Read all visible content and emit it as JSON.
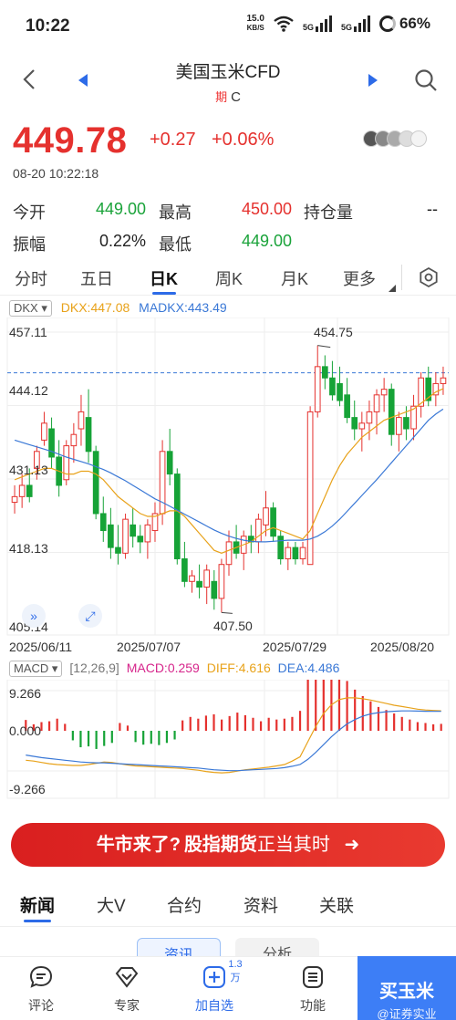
{
  "status": {
    "time": "10:22",
    "net_speed": "15.0",
    "net_unit": "KB/S",
    "sig1": "5G",
    "sig2": "5G",
    "battery": "66%"
  },
  "header": {
    "title": "美国玉米CFD",
    "badge": "期",
    "code": "C"
  },
  "quote": {
    "price": "449.78",
    "change": "+0.27",
    "change_pct": "+0.06%",
    "time": "08-20 10:22:18"
  },
  "stats": [
    {
      "label": "今开",
      "value": "449.00",
      "color": "green"
    },
    {
      "label": "最高",
      "value": "450.00",
      "color": "red"
    },
    {
      "label": "持仓量",
      "value": "--",
      "color": "plain"
    },
    {
      "label": "振幅",
      "value": "0.22%",
      "color": "plain"
    },
    {
      "label": "最低",
      "value": "449.00",
      "color": "green"
    }
  ],
  "tabs": [
    "分时",
    "五日",
    "日K",
    "周K",
    "月K",
    "更多"
  ],
  "active_tab": "日K",
  "kline": {
    "indicator": "DKX",
    "dkx_label": "DKX:447.08",
    "madkx_label": "MADKX:443.49",
    "y_ticks": [
      "457.11",
      "444.12",
      "431.13",
      "418.13",
      "405.14"
    ],
    "x_ticks": [
      "2025/06/11",
      "2025/07/07",
      "2025/07/29",
      "2025/08/20"
    ],
    "high_label": "454.75",
    "low_label": "407.50"
  },
  "macd": {
    "indicator": "MACD",
    "params": "[12,26,9]",
    "macd_label": "MACD:0.259",
    "diff_label": "DIFF:4.616",
    "dea_label": "DEA:4.486",
    "y_ticks": [
      "9.266",
      "0.000",
      "-9.266"
    ]
  },
  "chart_data": {
    "type": "candlestick",
    "ylim": [
      405.14,
      457.11
    ],
    "candles": [
      {
        "o": 427,
        "h": 430,
        "l": 425,
        "c": 428
      },
      {
        "o": 428,
        "h": 432,
        "l": 426,
        "c": 430
      },
      {
        "o": 430,
        "h": 433,
        "l": 427,
        "c": 428
      },
      {
        "o": 433,
        "h": 437,
        "l": 431,
        "c": 436
      },
      {
        "o": 438,
        "h": 443,
        "l": 437,
        "c": 441
      },
      {
        "o": 440,
        "h": 442,
        "l": 433,
        "c": 435
      },
      {
        "o": 435,
        "h": 438,
        "l": 428,
        "c": 430
      },
      {
        "o": 431,
        "h": 438,
        "l": 430,
        "c": 437
      },
      {
        "o": 437,
        "h": 441,
        "l": 434,
        "c": 439
      },
      {
        "o": 440,
        "h": 446,
        "l": 437,
        "c": 443
      },
      {
        "o": 442,
        "h": 447,
        "l": 434,
        "c": 436
      },
      {
        "o": 436,
        "h": 437,
        "l": 424,
        "c": 425
      },
      {
        "o": 425,
        "h": 428,
        "l": 420,
        "c": 422
      },
      {
        "o": 423,
        "h": 426,
        "l": 417,
        "c": 419
      },
      {
        "o": 419,
        "h": 423,
        "l": 416,
        "c": 418
      },
      {
        "o": 418,
        "h": 425,
        "l": 417,
        "c": 424
      },
      {
        "o": 423,
        "h": 426,
        "l": 419,
        "c": 421
      },
      {
        "o": 421,
        "h": 423,
        "l": 418,
        "c": 420
      },
      {
        "o": 420,
        "h": 424,
        "l": 417,
        "c": 423
      },
      {
        "o": 422,
        "h": 427,
        "l": 420,
        "c": 425
      },
      {
        "o": 425,
        "h": 438,
        "l": 423,
        "c": 436
      },
      {
        "o": 436,
        "h": 440,
        "l": 430,
        "c": 432
      },
      {
        "o": 432,
        "h": 433,
        "l": 416,
        "c": 417
      },
      {
        "o": 417,
        "h": 420,
        "l": 412,
        "c": 413
      },
      {
        "o": 413,
        "h": 415,
        "l": 411,
        "c": 414
      },
      {
        "o": 413,
        "h": 416,
        "l": 410,
        "c": 412
      },
      {
        "o": 412,
        "h": 416,
        "l": 409,
        "c": 415
      },
      {
        "o": 413,
        "h": 415,
        "l": 408,
        "c": 410
      },
      {
        "o": 410,
        "h": 417,
        "l": 407.5,
        "c": 416
      },
      {
        "o": 416,
        "h": 422,
        "l": 414,
        "c": 420
      },
      {
        "o": 420,
        "h": 423,
        "l": 417,
        "c": 418
      },
      {
        "o": 418,
        "h": 422,
        "l": 415,
        "c": 421
      },
      {
        "o": 421,
        "h": 423,
        "l": 418,
        "c": 420
      },
      {
        "o": 420,
        "h": 425,
        "l": 418,
        "c": 424
      },
      {
        "o": 423,
        "h": 429,
        "l": 421,
        "c": 426
      },
      {
        "o": 426,
        "h": 427,
        "l": 420,
        "c": 421
      },
      {
        "o": 421,
        "h": 422,
        "l": 416,
        "c": 417
      },
      {
        "o": 417,
        "h": 420,
        "l": 415,
        "c": 419
      },
      {
        "o": 419,
        "h": 420,
        "l": 416,
        "c": 417
      },
      {
        "o": 417,
        "h": 420,
        "l": 416,
        "c": 419
      },
      {
        "o": 416,
        "h": 444,
        "l": 416,
        "c": 443
      },
      {
        "o": 443,
        "h": 454.75,
        "l": 442,
        "c": 451
      },
      {
        "o": 451,
        "h": 453,
        "l": 447,
        "c": 449
      },
      {
        "o": 449,
        "h": 452,
        "l": 445,
        "c": 446
      },
      {
        "o": 448,
        "h": 451,
        "l": 444,
        "c": 445
      },
      {
        "o": 446,
        "h": 449,
        "l": 441,
        "c": 442
      },
      {
        "o": 442,
        "h": 445,
        "l": 438,
        "c": 440
      },
      {
        "o": 440,
        "h": 443,
        "l": 436,
        "c": 441
      },
      {
        "o": 441,
        "h": 445,
        "l": 438,
        "c": 443
      },
      {
        "o": 443,
        "h": 447,
        "l": 439,
        "c": 446
      },
      {
        "o": 446,
        "h": 449,
        "l": 443,
        "c": 447
      },
      {
        "o": 447,
        "h": 448,
        "l": 437,
        "c": 439
      },
      {
        "o": 439,
        "h": 443,
        "l": 436,
        "c": 442
      },
      {
        "o": 442,
        "h": 444,
        "l": 438,
        "c": 440
      },
      {
        "o": 440,
        "h": 446,
        "l": 438,
        "c": 444
      },
      {
        "o": 444,
        "h": 450,
        "l": 442,
        "c": 449
      },
      {
        "o": 449,
        "h": 451,
        "l": 444,
        "c": 445
      },
      {
        "o": 446,
        "h": 450,
        "l": 444,
        "c": 448
      },
      {
        "o": 448,
        "h": 451,
        "l": 446,
        "c": 449
      }
    ],
    "dkx": [
      431,
      431.5,
      432,
      432.5,
      433,
      433,
      432.5,
      432,
      432,
      432.5,
      432.5,
      432,
      431,
      429.5,
      428,
      427,
      426,
      425,
      424.5,
      424.5,
      425,
      425.5,
      425.5,
      424.5,
      423,
      421.5,
      420,
      418.5,
      418,
      418.5,
      419,
      419.5,
      420,
      421,
      422,
      422.5,
      422,
      421.5,
      421,
      420.5,
      422,
      425,
      428,
      431,
      433.5,
      435.5,
      437,
      438.5,
      439.5,
      440.5,
      441.5,
      442,
      442.5,
      443,
      443.5,
      444.5,
      445.5,
      446.5,
      447.08
    ],
    "madkx": [
      438,
      437.6,
      437.2,
      436.8,
      436.4,
      436,
      435.5,
      435,
      434.6,
      434.2,
      433.8,
      433.3,
      432.8,
      432.2,
      431.5,
      430.8,
      430,
      429.2,
      428.4,
      427.6,
      427,
      426.3,
      425.6,
      424.9,
      424.2,
      423.5,
      422.8,
      422.1,
      421.5,
      421,
      420.6,
      420.3,
      420.1,
      420,
      420,
      420.1,
      420.2,
      420.3,
      420.3,
      420.3,
      420.5,
      421,
      421.8,
      422.8,
      424,
      425.4,
      426.8,
      428.2,
      429.6,
      431,
      432.5,
      434,
      435.5,
      437,
      438.5,
      440,
      441.5,
      442.6,
      443.49
    ],
    "macd_hist": [
      2.5,
      1.5,
      2.0,
      2.2,
      2.8,
      1.6,
      -2.2,
      -3.8,
      -3.6,
      -4.2,
      -3.5,
      -2.8,
      1.8,
      1.2,
      -2.6,
      -3.2,
      -3.0,
      -3.3,
      -2.8,
      -2.0,
      2.4,
      3.2,
      2.8,
      3.5,
      3.8,
      2.6,
      3.4,
      4.2,
      3.6,
      3.0,
      2.2,
      3.0,
      2.6,
      2.8,
      3.2,
      4.6,
      16.5,
      18.0,
      17.0,
      15.5,
      13.5,
      11.5,
      9.5,
      8.0,
      6.8,
      5.5,
      4.8,
      4.0,
      3.2,
      2.6,
      2.0,
      1.8,
      1.5,
      1.6
    ],
    "diff": [
      -6.8,
      -7.0,
      -7.3,
      -7.6,
      -7.8,
      -7.9,
      -8.0,
      -8.0,
      -7.8,
      -7.5,
      -7.2,
      -7.3,
      -7.6,
      -7.9,
      -8.1,
      -8.2,
      -8.3,
      -8.4,
      -8.5,
      -8.6,
      -8.7,
      -8.9,
      -9.1,
      -9.4,
      -9.6,
      -9.7,
      -9.6,
      -9.3,
      -9.0,
      -8.8,
      -8.6,
      -8.4,
      -8.1,
      -7.8,
      -7.0,
      -6.0,
      -2.5,
      1.0,
      4.0,
      6.0,
      7.2,
      7.6,
      7.6,
      7.4,
      7.1,
      6.7,
      6.3,
      5.9,
      5.6,
      5.3,
      5.0,
      4.8,
      4.7,
      4.616
    ],
    "dea": [
      -5.6,
      -5.9,
      -6.2,
      -6.4,
      -6.6,
      -6.8,
      -7.0,
      -7.2,
      -7.3,
      -7.4,
      -7.4,
      -7.5,
      -7.6,
      -7.7,
      -7.8,
      -7.9,
      -8.0,
      -8.1,
      -8.2,
      -8.3,
      -8.4,
      -8.5,
      -8.6,
      -8.8,
      -9.0,
      -9.1,
      -9.2,
      -9.2,
      -9.1,
      -9.0,
      -8.9,
      -8.8,
      -8.7,
      -8.5,
      -8.2,
      -7.8,
      -6.6,
      -5.0,
      -3.2,
      -1.4,
      0.2,
      1.6,
      2.6,
      3.4,
      3.9,
      4.2,
      4.4,
      4.5,
      4.6,
      4.6,
      4.55,
      4.5,
      4.49,
      4.486
    ]
  },
  "banner": {
    "part1": "牛市来了?",
    "part2": "股指期货",
    "part3": "正当其时",
    "arrow": "➜"
  },
  "news_tabs": [
    "新闻",
    "大V",
    "合约",
    "资料",
    "关联"
  ],
  "news_sub": [
    "资讯",
    "分析"
  ],
  "bottom_nav": [
    {
      "label": "评论"
    },
    {
      "label": "专家"
    },
    {
      "label": "加自选",
      "badge": "1.3万"
    },
    {
      "label": "功能"
    }
  ],
  "buy": {
    "label": "买玉米",
    "watermark": "@证券实业"
  }
}
